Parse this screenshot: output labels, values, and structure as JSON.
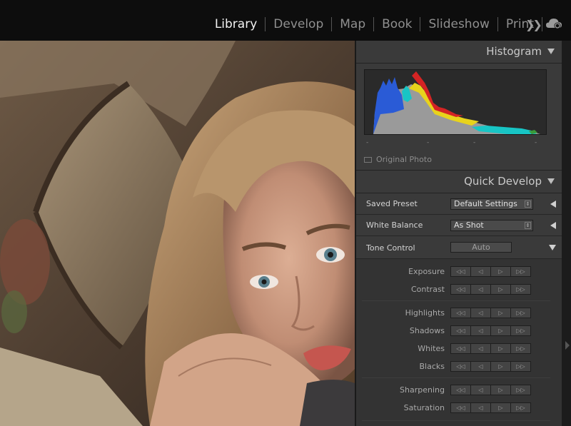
{
  "topbar": {
    "modules": [
      "Library",
      "Develop",
      "Map",
      "Book",
      "Slideshow",
      "Print"
    ],
    "active_module": "Library",
    "more_icon": "double-chevron-right-icon",
    "cloud_icon": "cloud-sync-icon"
  },
  "histogram": {
    "title": "Histogram",
    "ticks": [
      "-",
      "-",
      "-",
      "-"
    ],
    "original_photo_label": "Original Photo"
  },
  "quick_develop": {
    "title": "Quick Develop",
    "saved_preset": {
      "label": "Saved Preset",
      "value": "Default Settings"
    },
    "white_balance": {
      "label": "White Balance",
      "value": "As Shot"
    },
    "tone_control": {
      "label": "Tone Control",
      "auto_label": "Auto"
    },
    "buttons": [
      "◁◁",
      "◁",
      "▷",
      "▷▷"
    ],
    "adjustments": {
      "exposure": "Exposure",
      "contrast": "Contrast",
      "highlights": "Highlights",
      "shadows": "Shadows",
      "whites": "Whites",
      "blacks": "Blacks",
      "sharpening": "Sharpening",
      "saturation": "Saturation"
    }
  },
  "colors": {
    "accent_active": "#f2f2f2",
    "panel_bg": "#2f2f2f",
    "histo_blue": "#2a5bd6",
    "histo_cyan": "#18c5c5",
    "histo_yellow": "#e8d31c",
    "histo_red": "#d42424"
  }
}
